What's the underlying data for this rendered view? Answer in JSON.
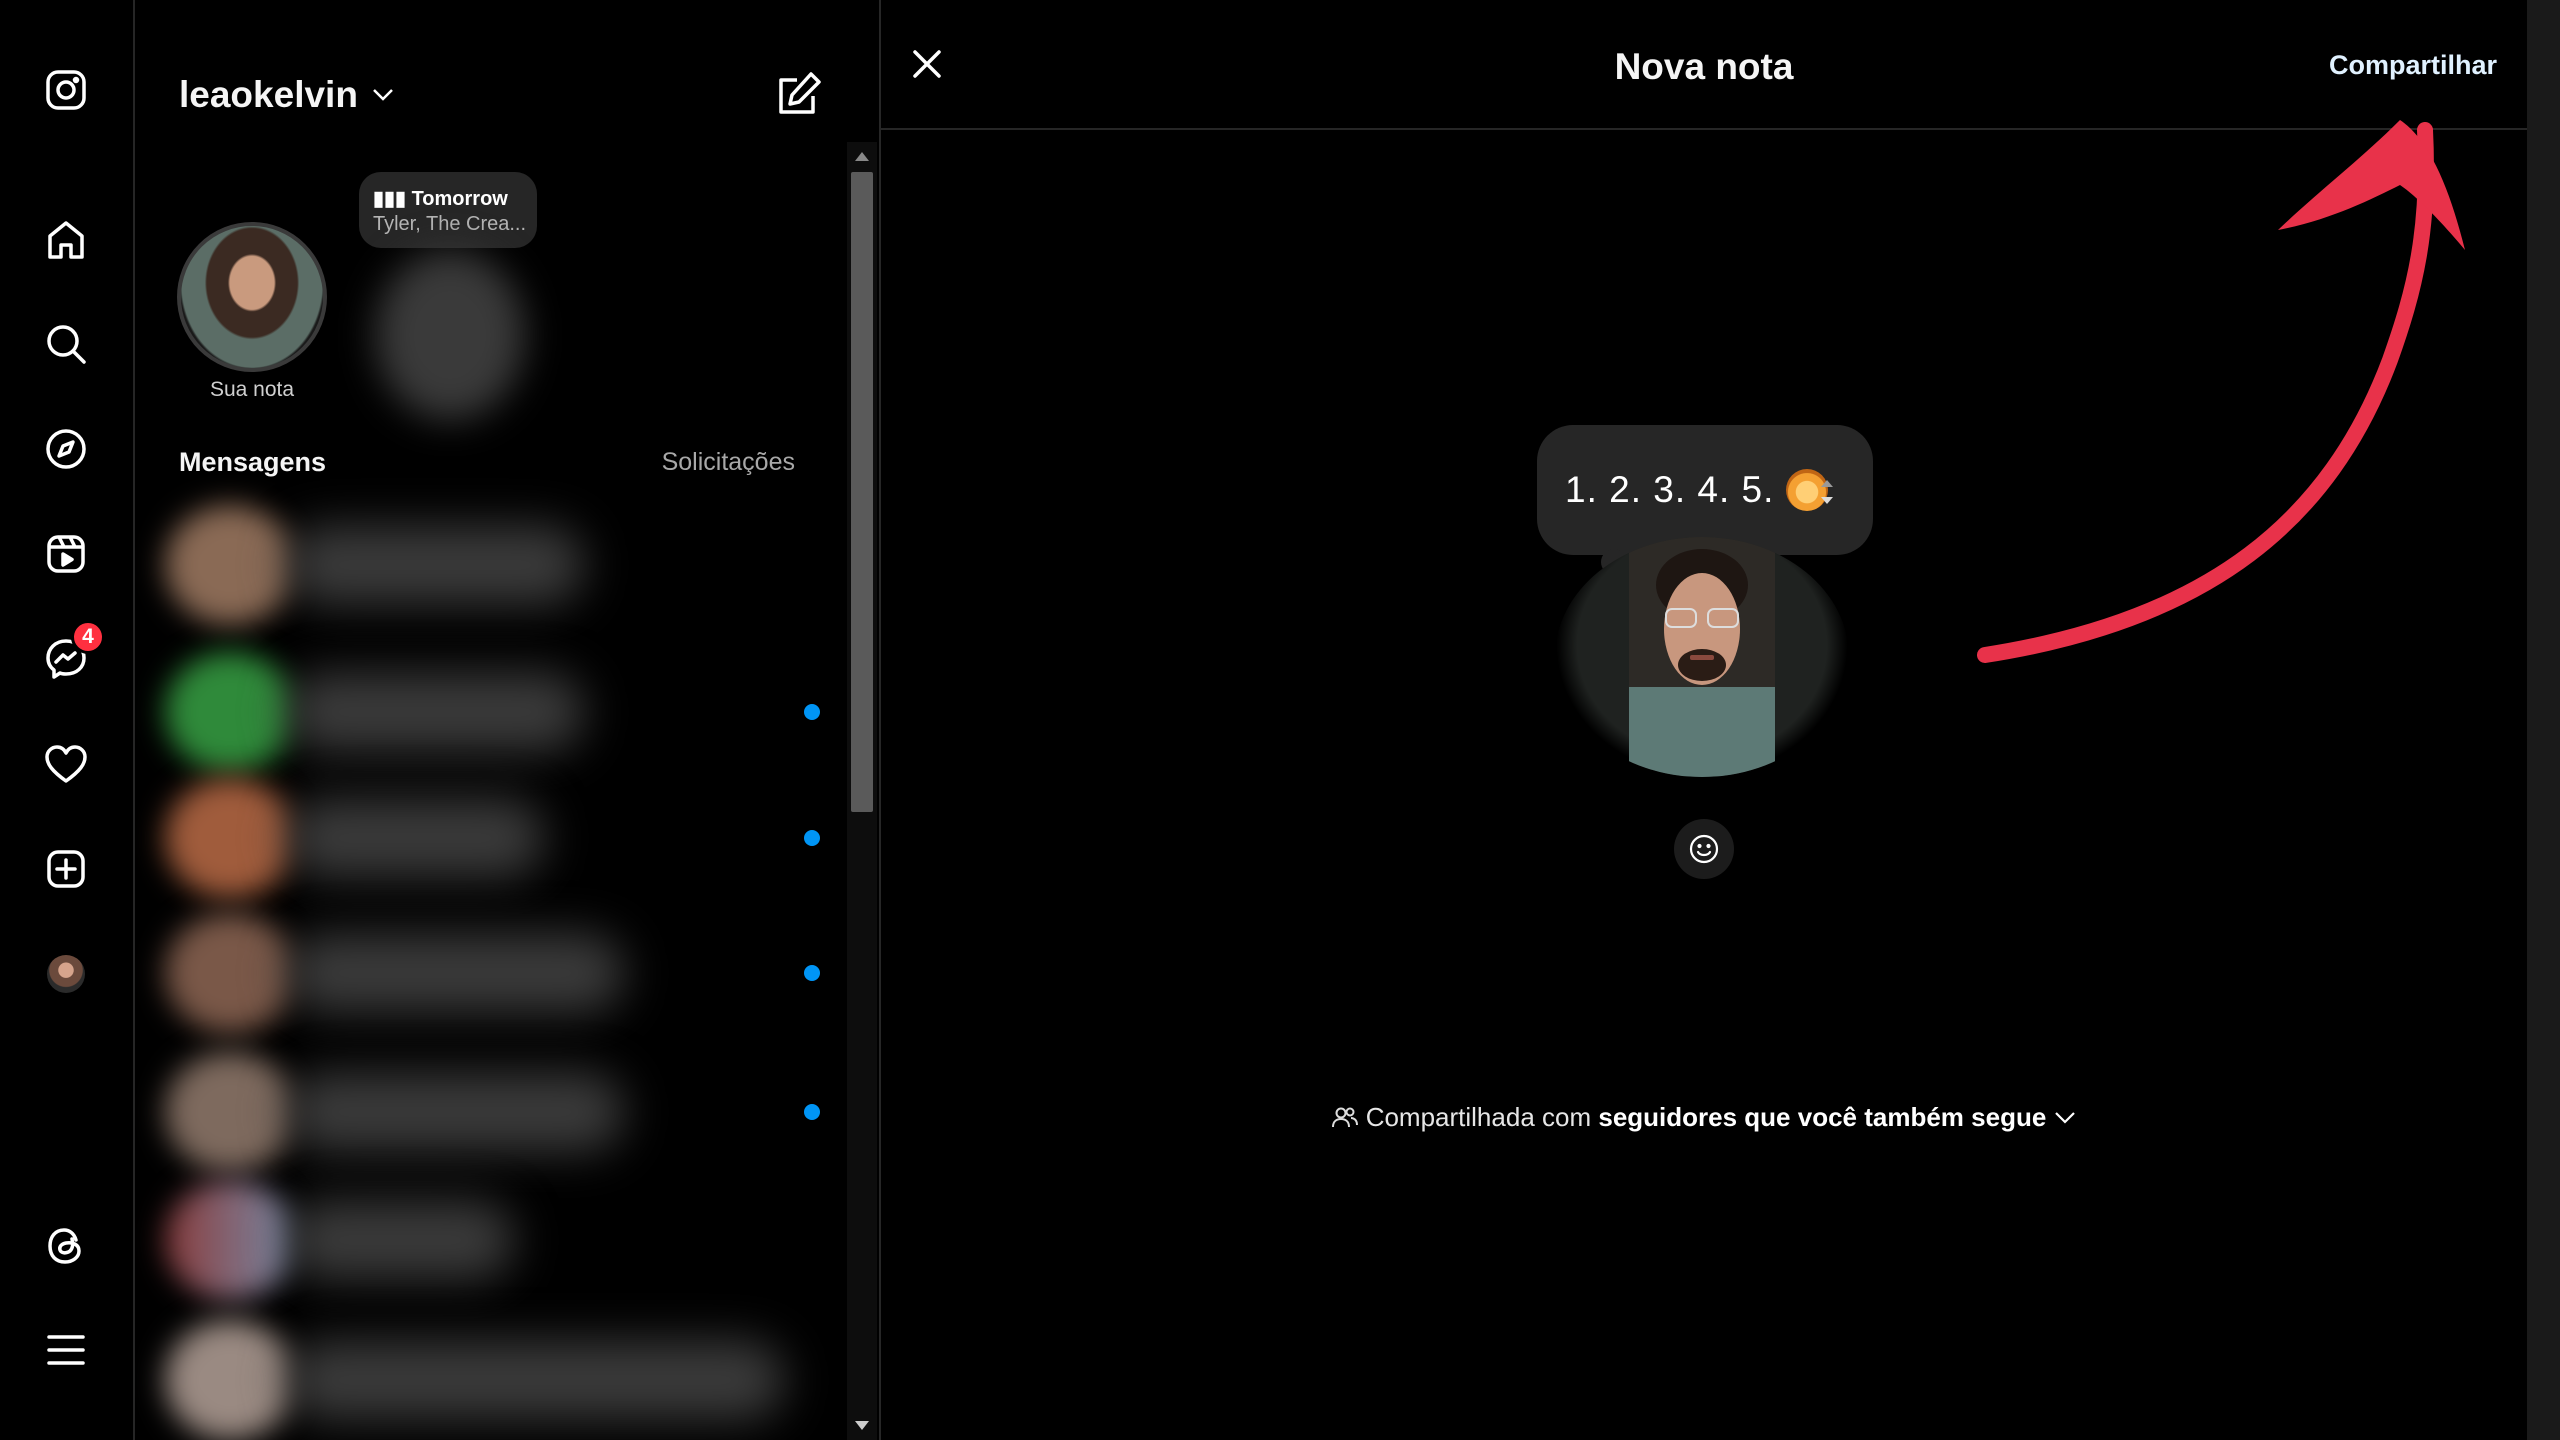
{
  "rail": {
    "items": [
      {
        "name": "instagram-logo-icon"
      },
      {
        "name": "home-icon"
      },
      {
        "name": "search-icon"
      },
      {
        "name": "explore-icon"
      },
      {
        "name": "reels-icon"
      },
      {
        "name": "messenger-icon"
      },
      {
        "name": "heart-icon"
      },
      {
        "name": "create-icon"
      },
      {
        "name": "profile-avatar"
      },
      {
        "name": "threads-icon"
      },
      {
        "name": "menu-icon"
      }
    ],
    "messages_badge": "4"
  },
  "inbox": {
    "username": "leaokelvin",
    "your_note_label": "Sua nota",
    "music": {
      "title": "Tomorrow",
      "artist": "Tyler, The Crea..."
    },
    "section_title": "Mensagens",
    "requests_label": "Solicitações"
  },
  "modal": {
    "title": "Nova nota",
    "share_label": "Compartilhar",
    "note_text": "1. 2. 3. 4. 5.",
    "note_emoji": "lion-face-emoji",
    "audience_prefix": "Compartilhada com",
    "audience_bold": "seguidores que você também segue"
  },
  "colors": {
    "background": "#000000",
    "unread_dot": "#0095f6",
    "badge": "#ff3040",
    "annotation_arrow": "#e8324a"
  }
}
